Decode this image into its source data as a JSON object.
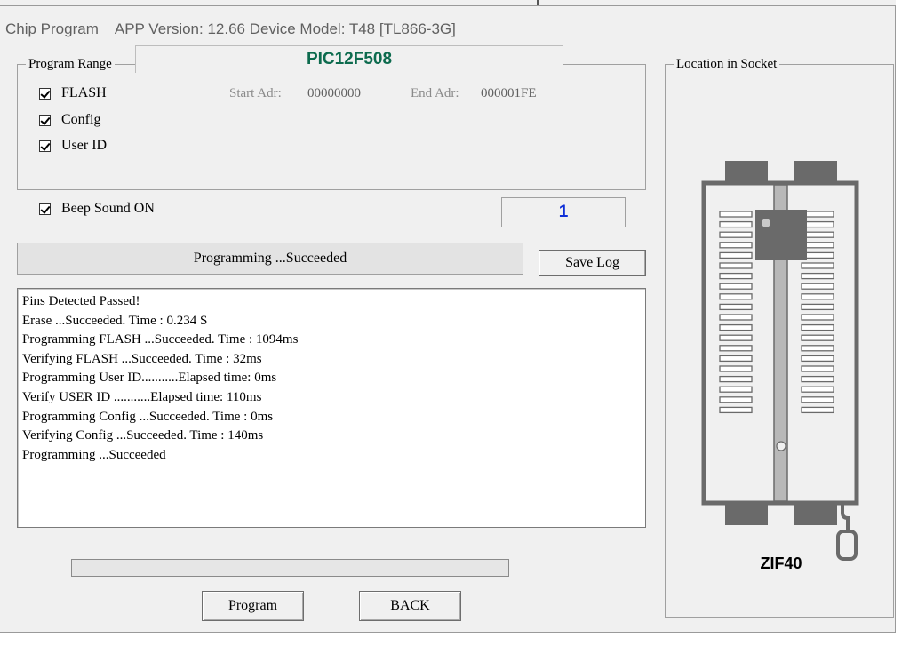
{
  "window": {
    "title": "Chip Program",
    "app_info": "APP Version: 12.66 Device Model: T48 [TL866-3G]"
  },
  "program_range": {
    "legend": "Program Range",
    "chip_name": "PIC12F508",
    "options": [
      {
        "label": "FLASH",
        "checked": true
      },
      {
        "label": "Config",
        "checked": true
      },
      {
        "label": "User ID",
        "checked": true
      }
    ],
    "start_adr_label": "Start Adr:",
    "start_adr_value": "00000000",
    "end_adr_label": "End Adr:",
    "end_adr_value": "000001FE"
  },
  "beep": {
    "label": "Beep Sound ON",
    "checked": true
  },
  "counter": "1",
  "status_text": "Programming  ...Succeeded",
  "buttons": {
    "save_log": "Save Log",
    "program": "Program",
    "back": "BACK"
  },
  "log_lines": [
    "Pins Detected Passed!",
    "Erase  ...Succeeded. Time : 0.234 S",
    "Programming FLASH ...Succeeded. Time : 1094ms",
    "Verifying FLASH ...Succeeded. Time : 32ms",
    "Programming User ID...........Elapsed time: 0ms",
    "Verify USER ID ...........Elapsed time: 110ms",
    "Programming Config ...Succeeded. Time : 0ms",
    "Verifying Config ...Succeeded. Time : 140ms",
    "Programming  ...Succeeded"
  ],
  "socket": {
    "legend": "Location in Socket",
    "label": "ZIF40"
  },
  "progress": {
    "value": 0
  },
  "colors": {
    "chip_name": "#0d6b4e",
    "counter": "#1030d8",
    "socket_gray": "#6a6a6a"
  }
}
